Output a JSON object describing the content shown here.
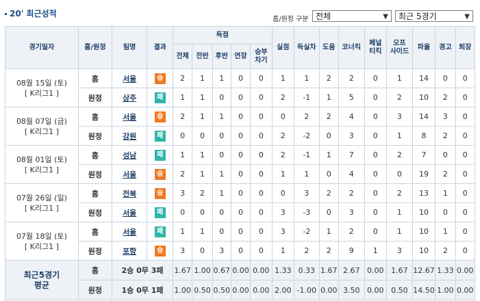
{
  "title": "20' 최근성적",
  "filter": {
    "label": "홈/원정 구분",
    "select1_value": "전체",
    "select2_value": "최근 5경기"
  },
  "headers": {
    "date": "경기일자",
    "homeaway": "홈/원정",
    "team": "팀명",
    "result": "결과",
    "goals_group": "득점",
    "total": "전체",
    "first_half": "전반",
    "second_half": "후반",
    "extra": "연장",
    "pk_l1": "승부",
    "pk_l2": "차기",
    "conceded": "실점",
    "goal_diff": "득실차",
    "assist": "도움",
    "corner": "코너킥",
    "pk_kick_l1": "페널",
    "pk_kick_l2": "티킥",
    "offside_l1": "오프",
    "offside_l2": "사이드",
    "foul": "파울",
    "warning": "경고",
    "sendoff": "퇴장"
  },
  "matches": [
    {
      "date": "08월 15일 (토)",
      "league": "[ K리그1 ]",
      "rows": [
        {
          "ha": "홈",
          "team": "서울",
          "result": "승",
          "res": "win",
          "stats": [
            "2",
            "1",
            "1",
            "0",
            "0",
            "1",
            "1",
            "2",
            "2",
            "0",
            "1",
            "14",
            "0",
            "0"
          ]
        },
        {
          "ha": "원정",
          "team": "상주",
          "result": "패",
          "res": "lose",
          "stats": [
            "1",
            "1",
            "0",
            "0",
            "0",
            "2",
            "-1",
            "1",
            "5",
            "0",
            "2",
            "10",
            "2",
            "0"
          ]
        }
      ]
    },
    {
      "date": "08월 07일 (금)",
      "league": "[ K리그1 ]",
      "rows": [
        {
          "ha": "홈",
          "team": "서울",
          "result": "승",
          "res": "win",
          "stats": [
            "2",
            "1",
            "1",
            "0",
            "0",
            "0",
            "2",
            "2",
            "4",
            "0",
            "3",
            "14",
            "3",
            "0"
          ]
        },
        {
          "ha": "원정",
          "team": "강원",
          "result": "패",
          "res": "lose",
          "stats": [
            "0",
            "0",
            "0",
            "0",
            "0",
            "2",
            "-2",
            "0",
            "3",
            "0",
            "1",
            "8",
            "2",
            "0"
          ]
        }
      ]
    },
    {
      "date": "08월 01일 (토)",
      "league": "[ K리그1 ]",
      "rows": [
        {
          "ha": "홈",
          "team": "성남",
          "result": "패",
          "res": "lose",
          "stats": [
            "1",
            "1",
            "0",
            "0",
            "0",
            "2",
            "-1",
            "1",
            "7",
            "0",
            "2",
            "7",
            "0",
            "0"
          ]
        },
        {
          "ha": "원정",
          "team": "서울",
          "result": "승",
          "res": "win",
          "stats": [
            "2",
            "1",
            "1",
            "0",
            "0",
            "1",
            "1",
            "0",
            "4",
            "0",
            "0",
            "19",
            "2",
            "0"
          ]
        }
      ]
    },
    {
      "date": "07월 26일 (일)",
      "league": "[ K리그1 ]",
      "rows": [
        {
          "ha": "홈",
          "team": "전북",
          "result": "승",
          "res": "win",
          "stats": [
            "3",
            "2",
            "1",
            "0",
            "0",
            "0",
            "3",
            "2",
            "2",
            "0",
            "2",
            "13",
            "1",
            "0"
          ]
        },
        {
          "ha": "원정",
          "team": "서울",
          "result": "패",
          "res": "lose",
          "stats": [
            "0",
            "0",
            "0",
            "0",
            "0",
            "3",
            "-3",
            "0",
            "3",
            "0",
            "1",
            "10",
            "0",
            "0"
          ]
        }
      ]
    },
    {
      "date": "07월 18일 (토)",
      "league": "[ K리그1 ]",
      "rows": [
        {
          "ha": "홈",
          "team": "서울",
          "result": "패",
          "res": "lose",
          "stats": [
            "1",
            "1",
            "0",
            "0",
            "0",
            "3",
            "-2",
            "1",
            "2",
            "0",
            "1",
            "10",
            "1",
            "0"
          ]
        },
        {
          "ha": "원정",
          "team": "포항",
          "result": "승",
          "res": "win",
          "stats": [
            "3",
            "0",
            "3",
            "0",
            "0",
            "1",
            "2",
            "2",
            "9",
            "1",
            "3",
            "10",
            "2",
            "0"
          ]
        }
      ]
    }
  ],
  "summary": {
    "label_l1": "최근5경기",
    "label_l2": "평균",
    "rows": [
      {
        "ha": "홈",
        "record": "2승 0무 3패",
        "stats": [
          "1.67",
          "1.00",
          "0.67",
          "0.00",
          "0.00",
          "1.33",
          "0.33",
          "1.67",
          "2.67",
          "0.00",
          "1.67",
          "12.67",
          "1.33",
          "0.00"
        ]
      },
      {
        "ha": "원정",
        "record": "1승 0무 1패",
        "stats": [
          "1.00",
          "0.50",
          "0.50",
          "0.00",
          "0.00",
          "2.00",
          "-1.00",
          "0.00",
          "3.50",
          "0.00",
          "0.50",
          "14.50",
          "1.00",
          "0.00"
        ]
      }
    ]
  }
}
